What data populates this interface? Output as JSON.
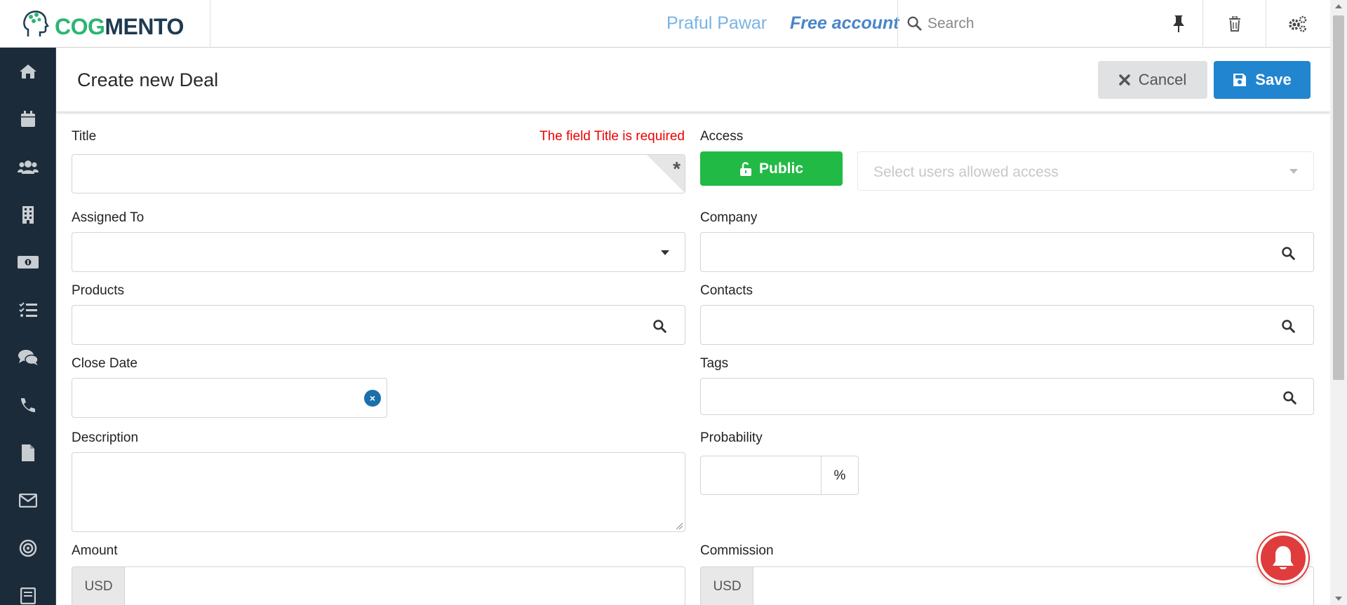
{
  "app": {
    "brand_part1": "COG",
    "brand_part2": "MENTO"
  },
  "header": {
    "user_name": "Praful Pawar",
    "account": "Free account",
    "search_placeholder": "Search"
  },
  "sidebar": {
    "items": [
      {
        "icon": "home-icon"
      },
      {
        "icon": "calendar-icon"
      },
      {
        "icon": "contacts-icon"
      },
      {
        "icon": "company-icon"
      },
      {
        "icon": "money-icon"
      },
      {
        "icon": "tasks-icon"
      },
      {
        "icon": "chat-icon"
      },
      {
        "icon": "phone-icon"
      },
      {
        "icon": "document-icon"
      },
      {
        "icon": "email-icon"
      },
      {
        "icon": "target-icon"
      },
      {
        "icon": "forms-icon"
      }
    ]
  },
  "page": {
    "title": "Create new Deal",
    "cancel_label": "Cancel",
    "save_label": "Save"
  },
  "form": {
    "title_label": "Title",
    "title_error": "The field Title is required",
    "access_label": "Access",
    "public_label": "Public",
    "access_placeholder": "Select users allowed access",
    "assigned_label": "Assigned To",
    "company_label": "Company",
    "products_label": "Products",
    "contacts_label": "Contacts",
    "close_date_label": "Close Date",
    "tags_label": "Tags",
    "description_label": "Description",
    "probability_label": "Probability",
    "percent_symbol": "%",
    "amount_label": "Amount",
    "commission_label": "Commission",
    "currency": "USD"
  },
  "colors": {
    "sidebar_bg": "#1b2b3a",
    "save_blue": "#2185d0",
    "public_green": "#21ba45",
    "error_red": "#ee0000",
    "bell_red": "#e03c3c"
  }
}
